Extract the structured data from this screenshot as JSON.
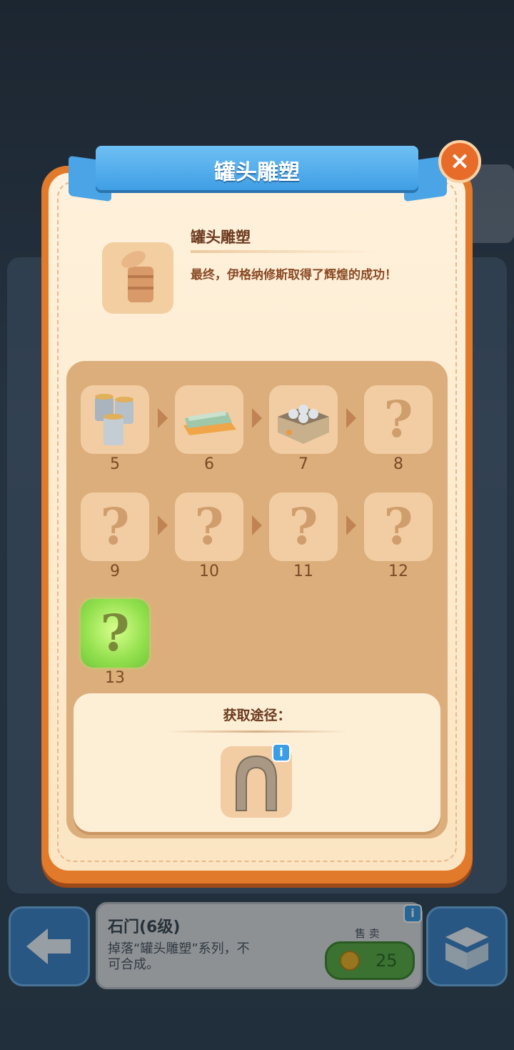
{
  "modal": {
    "title": "罐头雕塑",
    "close_label": "×",
    "item_name": "罐头雕塑",
    "item_desc": "最终，伊格纳修斯取得了辉煌的成功！",
    "chain": [
      {
        "level": "5",
        "state": "known",
        "icon": "stacked-cans-icon"
      },
      {
        "level": "6",
        "state": "known",
        "icon": "flattened-cans-icon"
      },
      {
        "level": "7",
        "state": "known",
        "icon": "crate-of-cans-icon"
      },
      {
        "level": "8",
        "state": "unknown",
        "glyph": "?"
      },
      {
        "level": "9",
        "state": "unknown",
        "glyph": "?"
      },
      {
        "level": "10",
        "state": "unknown",
        "glyph": "?"
      },
      {
        "level": "11",
        "state": "unknown",
        "glyph": "?"
      },
      {
        "level": "12",
        "state": "unknown",
        "glyph": "?"
      },
      {
        "level": "13",
        "state": "final",
        "glyph": "?"
      }
    ],
    "source_title": "获取途径：",
    "source_item_icon": "stone-arch-icon"
  },
  "bottom": {
    "item_title": "石门(6级)",
    "item_desc": "掉落“罐头雕塑”系列，不可合成。",
    "sell_label": "售 卖",
    "sell_price": "25",
    "info_glyph": "i"
  },
  "colors": {
    "modal_border": "#e27a2c",
    "ribbon": "#4aa4e6",
    "final_tile": "#93e04e"
  }
}
